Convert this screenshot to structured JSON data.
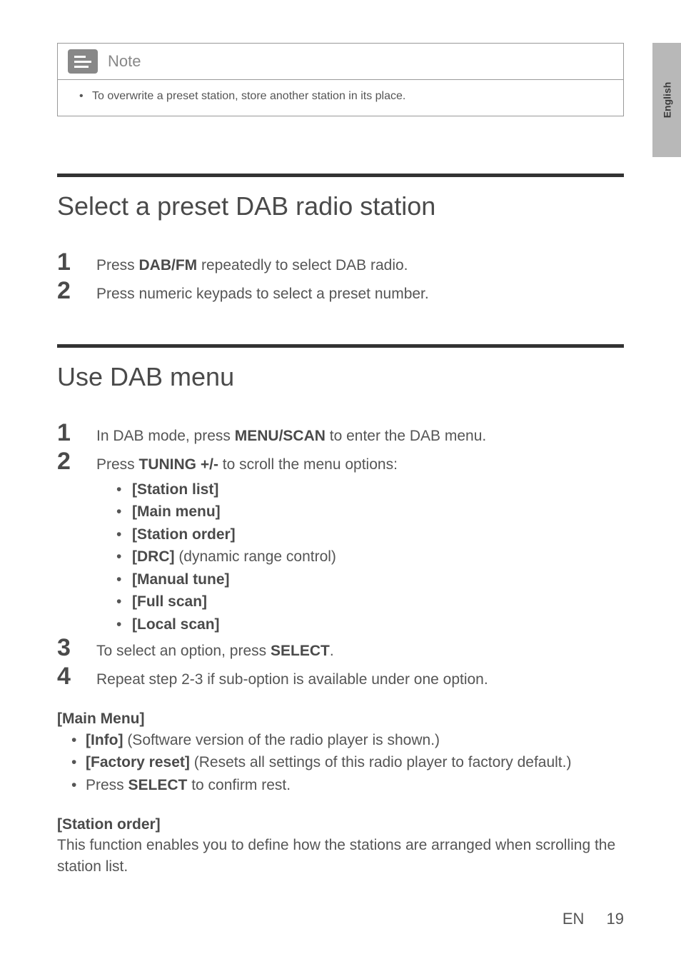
{
  "sideTab": {
    "label": "English"
  },
  "noteBox": {
    "title": "Note",
    "items": [
      "To overwrite a preset station, store another station in its place."
    ]
  },
  "section1": {
    "title": "Select a preset DAB radio station",
    "steps": [
      {
        "num": "1",
        "pre": "Press ",
        "bold": "DAB/FM",
        "post": " repeatedly to select DAB radio."
      },
      {
        "num": "2",
        "pre": "Press numeric keypads to select a preset number.",
        "bold": "",
        "post": ""
      }
    ]
  },
  "section2": {
    "title": "Use DAB menu",
    "step1": {
      "num": "1",
      "pre": "In DAB mode, press ",
      "bold": "MENU/SCAN",
      "post": " to enter the DAB menu."
    },
    "step2": {
      "num": "2",
      "pre": "Press ",
      "bold": "TUNING +/-",
      "post": " to scroll the menu options:"
    },
    "step2_bullets": [
      {
        "bold": "[Station list]",
        "rest": ""
      },
      {
        "bold": "[Main menu]",
        "rest": ""
      },
      {
        "bold": "[Station order]",
        "rest": ""
      },
      {
        "bold": "[DRC]",
        "rest": " (dynamic range control)"
      },
      {
        "bold": "[Manual tune]",
        "rest": ""
      },
      {
        "bold": "[Full scan]",
        "rest": ""
      },
      {
        "bold": "[Local scan]",
        "rest": ""
      }
    ],
    "step3": {
      "num": "3",
      "pre": "To select an option, press ",
      "bold": "SELECT",
      "post": "."
    },
    "step4": {
      "num": "4",
      "pre": "Repeat step 2-3 if sub-option is available under one option.",
      "bold": "",
      "post": ""
    },
    "mainMenu": {
      "title": "[Main Menu]",
      "bullets": [
        {
          "bold": "[Info]",
          "rest": " (Software version of the radio player is shown.)"
        },
        {
          "bold": "[Factory reset]",
          "rest": " (Resets all settings of this radio player to factory default.)"
        },
        {
          "pre": "Press ",
          "bold": "SELECT",
          "rest": " to confirm rest."
        }
      ]
    },
    "stationOrder": {
      "title": "[Station order]",
      "text": "This function enables you to define how the stations are arranged when scrolling the station list."
    }
  },
  "footer": {
    "lang": "EN",
    "page": "19"
  }
}
